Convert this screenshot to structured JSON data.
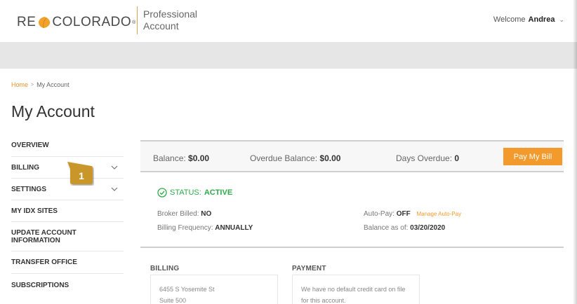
{
  "header": {
    "logo_left": "RE",
    "logo_right": "COLORADO",
    "logo_reg": "®",
    "subtitle": "Professional Account",
    "welcome_prefix": "Welcome",
    "welcome_user": "Andrea"
  },
  "breadcrumb": {
    "home": "Home",
    "separator": ">",
    "current": "My Account"
  },
  "page_title": "My Account",
  "sidebar": {
    "items": [
      {
        "label": "OVERVIEW"
      },
      {
        "label": "BILLING"
      },
      {
        "label": "SETTINGS"
      },
      {
        "label": "MY IDX SITES"
      },
      {
        "label": "UPDATE ACCOUNT INFORMATION"
      },
      {
        "label": "TRANSFER OFFICE"
      },
      {
        "label": "SUBSCRIPTIONS"
      }
    ]
  },
  "callout": {
    "number": "1"
  },
  "balance": {
    "balance_label": "Balance:",
    "balance_value": "$0.00",
    "overdue_label": "Overdue Balance:",
    "overdue_value": "$0.00",
    "days_label": "Days Overdue:",
    "days_value": "0",
    "pay_button": "Pay My Bill"
  },
  "status": {
    "label": "STATUS:",
    "value": "ACTIVE"
  },
  "details": {
    "broker_label": "Broker Billed:",
    "broker_value": "NO",
    "frequency_label": "Billing Frequency:",
    "frequency_value": "ANNUALLY",
    "autopay_label": "Auto-Pay:",
    "autopay_value": "OFF",
    "manage_link": "Manage Auto-Pay",
    "asof_label": "Balance as of:",
    "asof_value": "03/20/2020"
  },
  "billing_section": {
    "heading": "BILLING",
    "line1": "6455 S Yosemite St",
    "line2": "Suite 500"
  },
  "payment_section": {
    "heading": "PAYMENT",
    "text": "We have no default credit card on file for this account."
  },
  "colors": {
    "accent": "#f39a2d",
    "status_green": "#2eaa4a",
    "callout": "#c9962a"
  }
}
